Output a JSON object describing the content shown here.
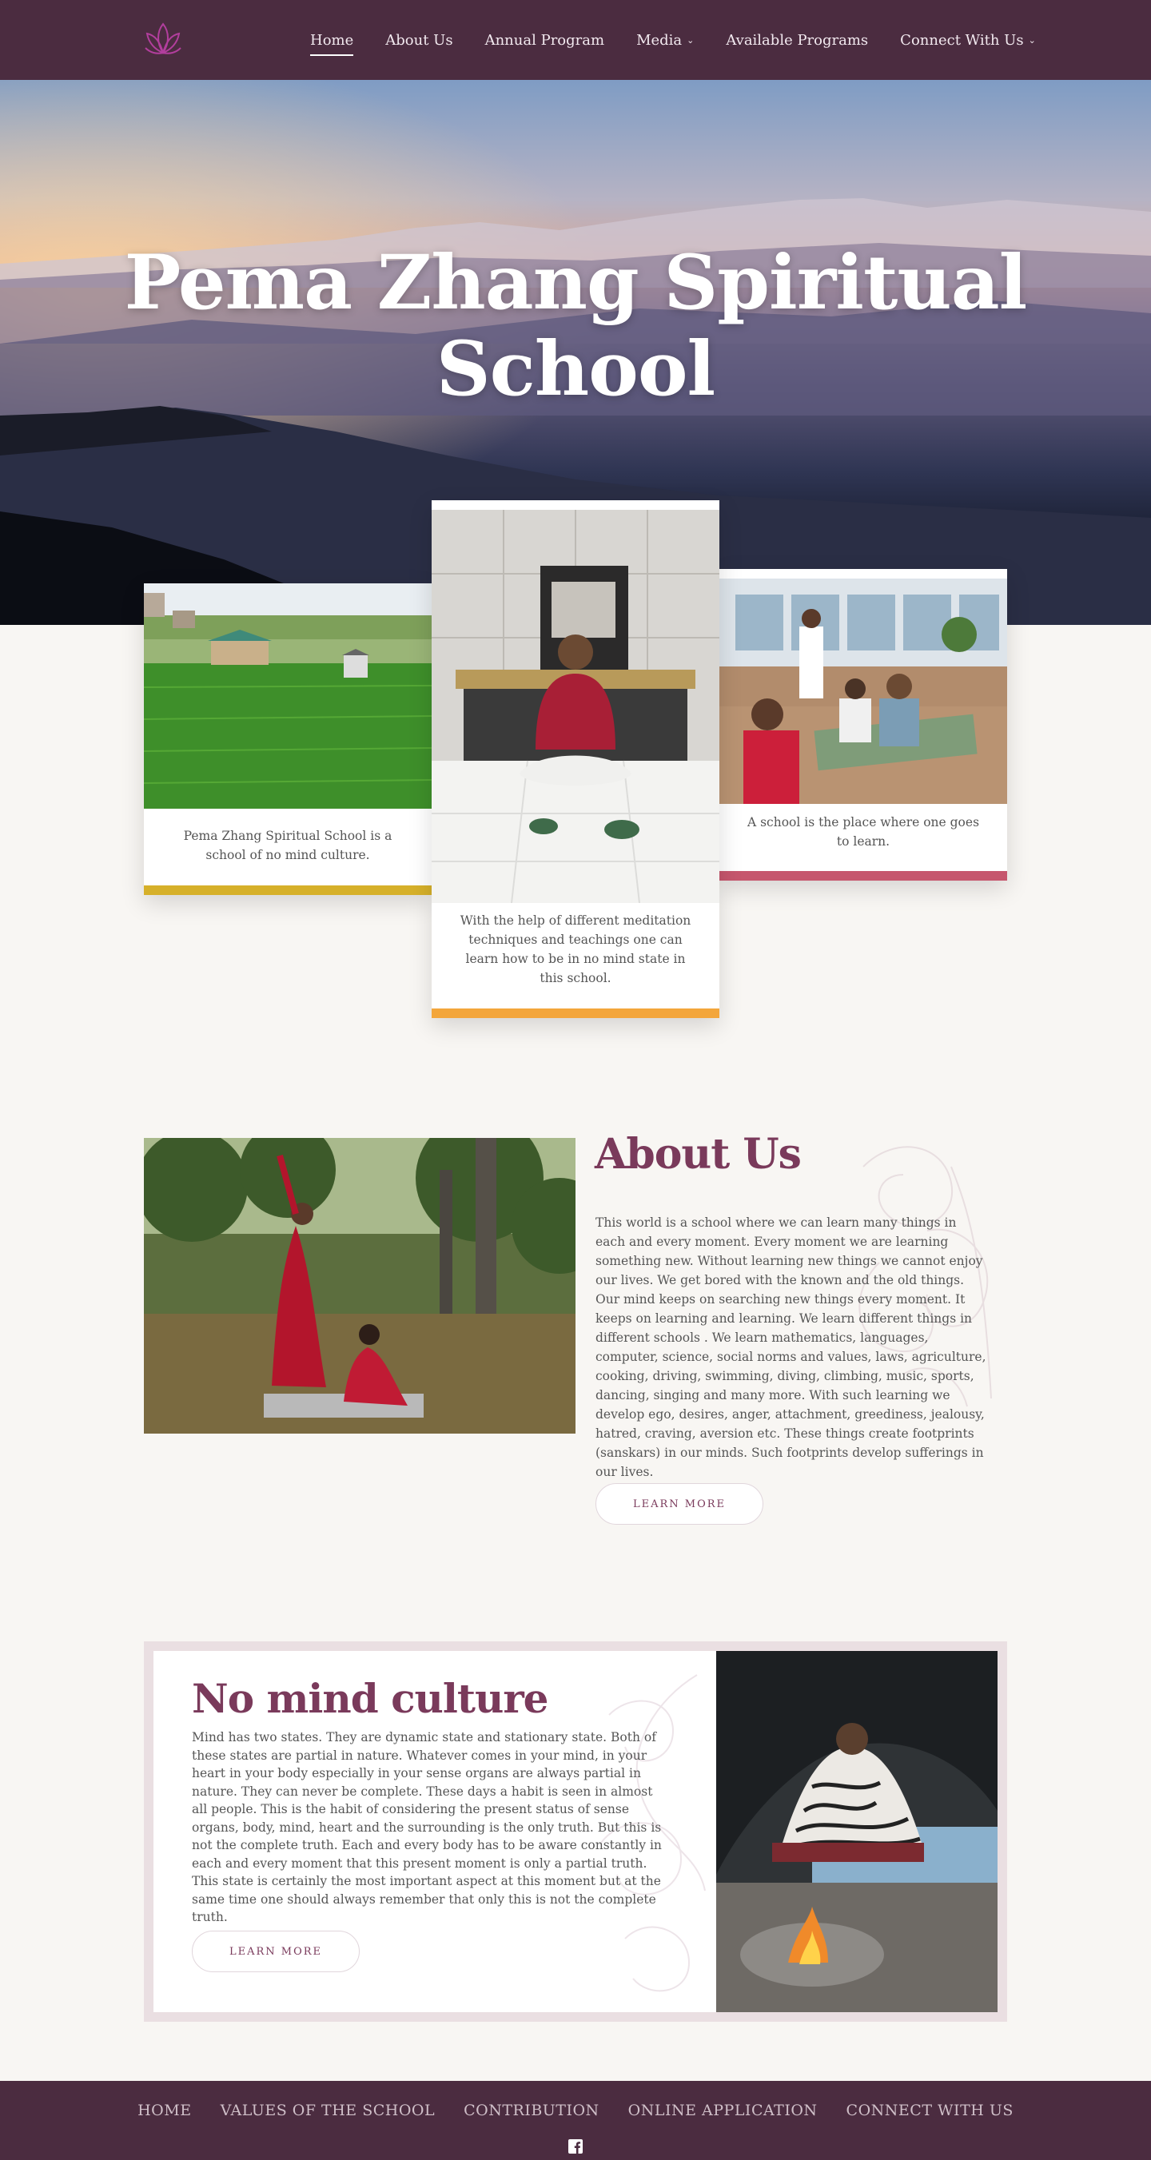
{
  "nav": {
    "logo_icon": "lotus-icon",
    "items": [
      {
        "label": "Home",
        "active": true,
        "dropdown": false
      },
      {
        "label": "About Us",
        "active": false,
        "dropdown": false
      },
      {
        "label": "Annual Program",
        "active": false,
        "dropdown": false
      },
      {
        "label": "Media",
        "active": false,
        "dropdown": true
      },
      {
        "label": "Available Programs",
        "active": false,
        "dropdown": false
      },
      {
        "label": "Connect With Us",
        "active": false,
        "dropdown": true
      }
    ]
  },
  "hero": {
    "title_line1": "Pema Zhang Spiritual",
    "title_line2": "School"
  },
  "cards": [
    {
      "caption": "Pema Zhang Spiritual School is a school of no mind culture.",
      "accent": "#d6b02a"
    },
    {
      "caption": "With the help of different meditation techniques and teachings one can learn how to be in no mind state in this school.",
      "accent": "#f3a63b"
    },
    {
      "caption": "A school is the place where one goes to learn.",
      "accent": "#c6566d"
    }
  ],
  "about": {
    "title": "About Us",
    "text": "This world is a school where we can learn many things in each and every moment. Every moment we are learning something new. Without learning new things we cannot enjoy our lives. We get bored with the known and the old things. Our mind keeps on searching new things every moment. It keeps on learning and learning. We learn different things in different schools . We learn mathematics, languages, computer, science, social norms and values, laws, agriculture, cooking, driving, swimming, diving, climbing, music, sports, dancing, singing and many more. With such learning we develop ego, desires, anger, attachment, greediness, jealousy, hatred, craving, aversion etc. These things create footprints (sanskars) in our minds. Such footprints develop sufferings in our lives.",
    "button": "LEARN MORE"
  },
  "nomind": {
    "title": "No mind culture",
    "text": "Mind has two states. They are dynamic state and stationary state. Both of these states are partial in nature. Whatever comes in your mind, in your heart in your body especially in your sense organs are always partial in nature. They can never be complete. These days a habit is seen in almost all people. This is the habit of considering the present status of sense organs, body, mind, heart and the surrounding is the only truth. But this is not the complete truth. Each and every body has to be aware constantly in each and every moment that this present moment is only a partial truth. This state is certainly the most important aspect at this moment but at the same time one should always remember that only this is not the complete truth.",
    "button": "LEARN MORE"
  },
  "footer": {
    "links": [
      "HOME",
      "VALUES OF THE SCHOOL",
      "CONTRIBUTION",
      "ONLINE APPLICATION",
      "CONNECT WITH US"
    ],
    "social_icon": "facebook-icon"
  },
  "colors": {
    "nav_bg": "#4b2c40",
    "heading": "#7a3a5b",
    "page_bg": "#f8f6f3"
  }
}
